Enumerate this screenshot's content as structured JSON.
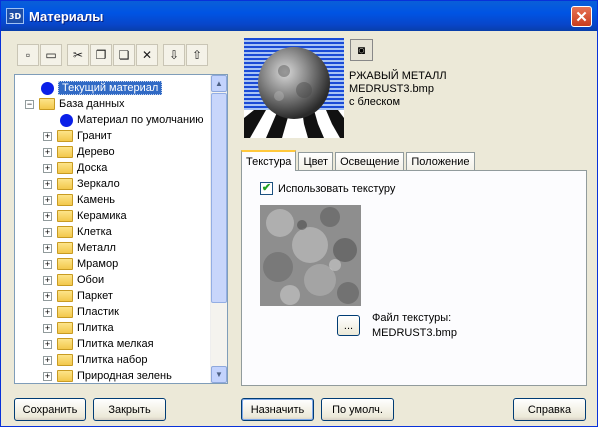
{
  "window": {
    "title": "Материалы",
    "app_icon_text": "3D",
    "close_glyph": "✕"
  },
  "toolbar": {
    "buttons": [
      {
        "name": "new-material",
        "icon": "new-file-icon",
        "glyph": "▫"
      },
      {
        "name": "folder",
        "icon": "folder-icon",
        "glyph": "▭"
      },
      {
        "name": "cut",
        "icon": "scissors-icon",
        "glyph": "✂"
      },
      {
        "name": "copy",
        "icon": "copy-icon",
        "glyph": "❐"
      },
      {
        "name": "paste",
        "icon": "paste-icon",
        "glyph": "❏"
      },
      {
        "name": "delete",
        "icon": "delete-icon",
        "glyph": "✕"
      },
      {
        "name": "import",
        "icon": "import-icon",
        "glyph": "⇩"
      },
      {
        "name": "export",
        "icon": "export-icon",
        "glyph": "⇧"
      }
    ]
  },
  "tree": {
    "current_material": "Текущий материал",
    "database": "База данных",
    "default_material": "Материал по умолчанию",
    "folders": [
      "Гранит",
      "Дерево",
      "Доска",
      "Зеркало",
      "Камень",
      "Керамика",
      "Клетка",
      "Металл",
      "Мрамор",
      "Обои",
      "Паркет",
      "Пластик",
      "Плитка",
      "Плитка мелкая",
      "Плитка набор",
      "Природная зелень"
    ],
    "expander_collapsed": "+",
    "expander_expanded": "−",
    "scroll_up": "▲",
    "scroll_down": "▼"
  },
  "buttons": {
    "save": "Сохранить",
    "close": "Закрыть",
    "assign": "Назначить",
    "default": "По умолч.",
    "help": "Справка"
  },
  "preview": {
    "name_line1": "РЖАВЫЙ МЕТАЛЛ",
    "name_line2": "MEDRUST3.bmp",
    "name_line3": "с блеском",
    "snapshot_glyph": "◙"
  },
  "tabs": [
    "Текстура",
    "Цвет",
    "Освещение",
    "Положение"
  ],
  "texture_tab": {
    "use_texture_label": "Использовать текстуру",
    "use_texture_checked": true,
    "check_glyph": "✔",
    "browse_label": "...",
    "file_label": "Файл текстуры:",
    "file_name": "MEDRUST3.bmp"
  },
  "colors": {
    "title_bar": "#0054e3",
    "selection": "#316ac5",
    "dialog_bg": "#ece9d8",
    "tab_highlight": "#ffc83c"
  }
}
